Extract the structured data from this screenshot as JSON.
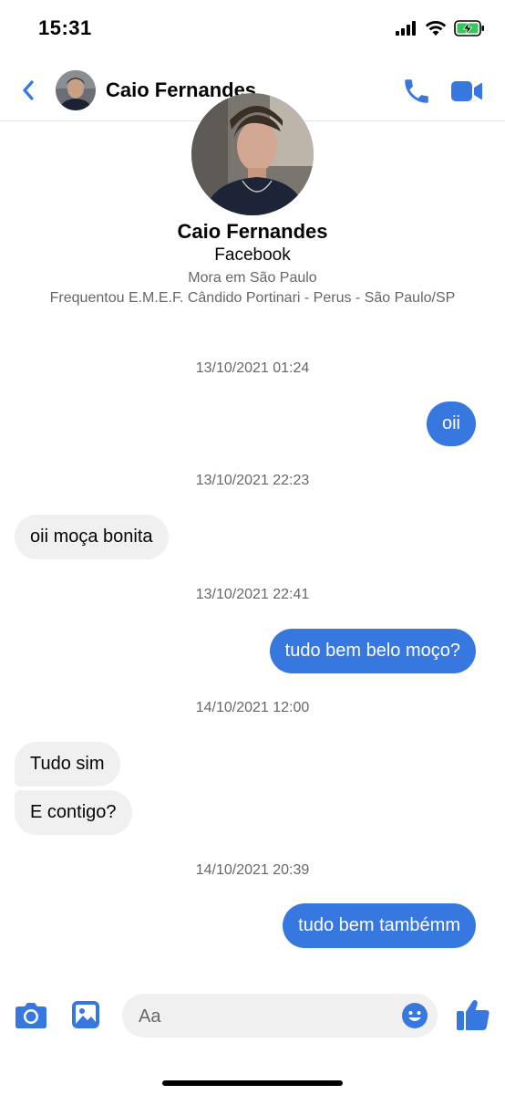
{
  "status_bar": {
    "time": "15:31"
  },
  "header": {
    "contact_name": "Caio Fernandes"
  },
  "profile": {
    "name": "Caio Fernandes",
    "source": "Facebook",
    "location": "Mora em São Paulo",
    "education": "Frequentou E.M.E.F. Cândido Portinari - Perus - São Paulo/SP"
  },
  "conversation": [
    {
      "type": "timestamp",
      "text": "13/10/2021 01:24"
    },
    {
      "type": "message",
      "direction": "out",
      "text": "oii"
    },
    {
      "type": "timestamp",
      "text": "13/10/2021 22:23"
    },
    {
      "type": "message",
      "direction": "in",
      "text": "oii moça bonita"
    },
    {
      "type": "timestamp",
      "text": "13/10/2021 22:41"
    },
    {
      "type": "message",
      "direction": "out",
      "text": "tudo bem belo moço?"
    },
    {
      "type": "timestamp",
      "text": "14/10/2021 12:00"
    },
    {
      "type": "message",
      "direction": "in",
      "text": "Tudo sim"
    },
    {
      "type": "message",
      "direction": "in",
      "text": "E contigo?"
    },
    {
      "type": "timestamp",
      "text": "14/10/2021 20:39"
    },
    {
      "type": "message",
      "direction": "out",
      "text": "tudo bem tambémm"
    }
  ],
  "composer": {
    "placeholder": "Aa"
  },
  "icons": {
    "back": "chevron-left-icon",
    "call": "phone-icon",
    "video": "video-camera-icon",
    "camera": "camera-icon",
    "gallery": "image-icon",
    "emoji": "smiley-icon",
    "like": "thumbs-up-icon"
  },
  "colors": {
    "accent": "#3777e0",
    "outgoing_bubble": "#3777e0",
    "incoming_bubble": "#f0f0f0",
    "secondary_text": "#65676b",
    "battery_charging": "#34c759"
  }
}
